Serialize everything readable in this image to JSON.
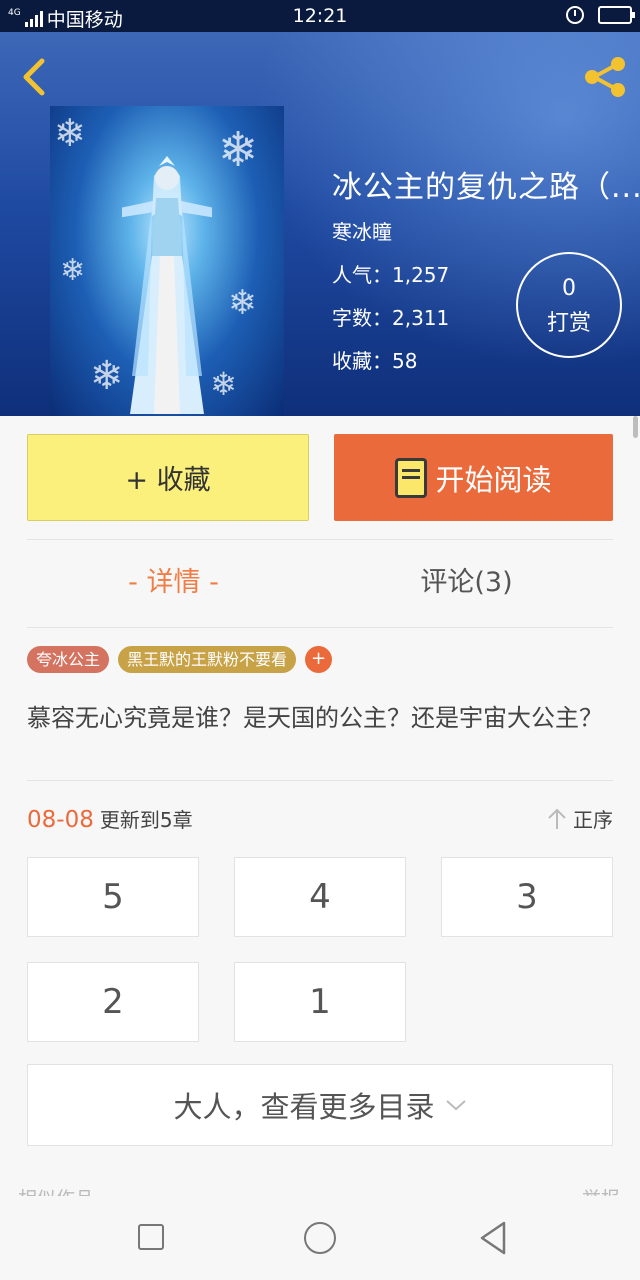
{
  "status_bar": {
    "network": "4G",
    "carrier": "中国移动",
    "time": "12:21"
  },
  "book": {
    "title": "冰公主的复仇之路（...",
    "author": "寒冰瞳",
    "popularity": "人气：1,257",
    "word_count": "字数：2,311",
    "favorites": "收藏：58"
  },
  "reward": {
    "count": "0",
    "label": "打赏"
  },
  "actions": {
    "collect_label": "+ 收藏",
    "read_label": "开始阅读"
  },
  "tabs": {
    "details": "- 详情 -",
    "comments": "评论(3)"
  },
  "tags": [
    "夸冰公主",
    "黑王默的王默粉不要看"
  ],
  "tag_add": "+",
  "description": "慕容无心究竟是谁？是天国的公主？还是宇宙大公主？",
  "update": {
    "date": "08-08",
    "text": "更新到5章",
    "order_label": "正序"
  },
  "chapters": [
    "5",
    "4",
    "3",
    "2",
    "1"
  ],
  "more_catalog": "大人，查看更多目录",
  "footer_peek": {
    "similar": "相似作品",
    "report": "举报"
  },
  "colors": {
    "accent_orange": "#eb6a3b",
    "collect_yellow": "#fbf07b",
    "tab_active": "#f07d45",
    "icon_gold": "#f2c230"
  },
  "icons": {
    "back": "chevron-left-icon",
    "share": "share-icon",
    "book": "book-icon",
    "order": "arrow-up-icon",
    "more": "chevron-down-icon"
  }
}
